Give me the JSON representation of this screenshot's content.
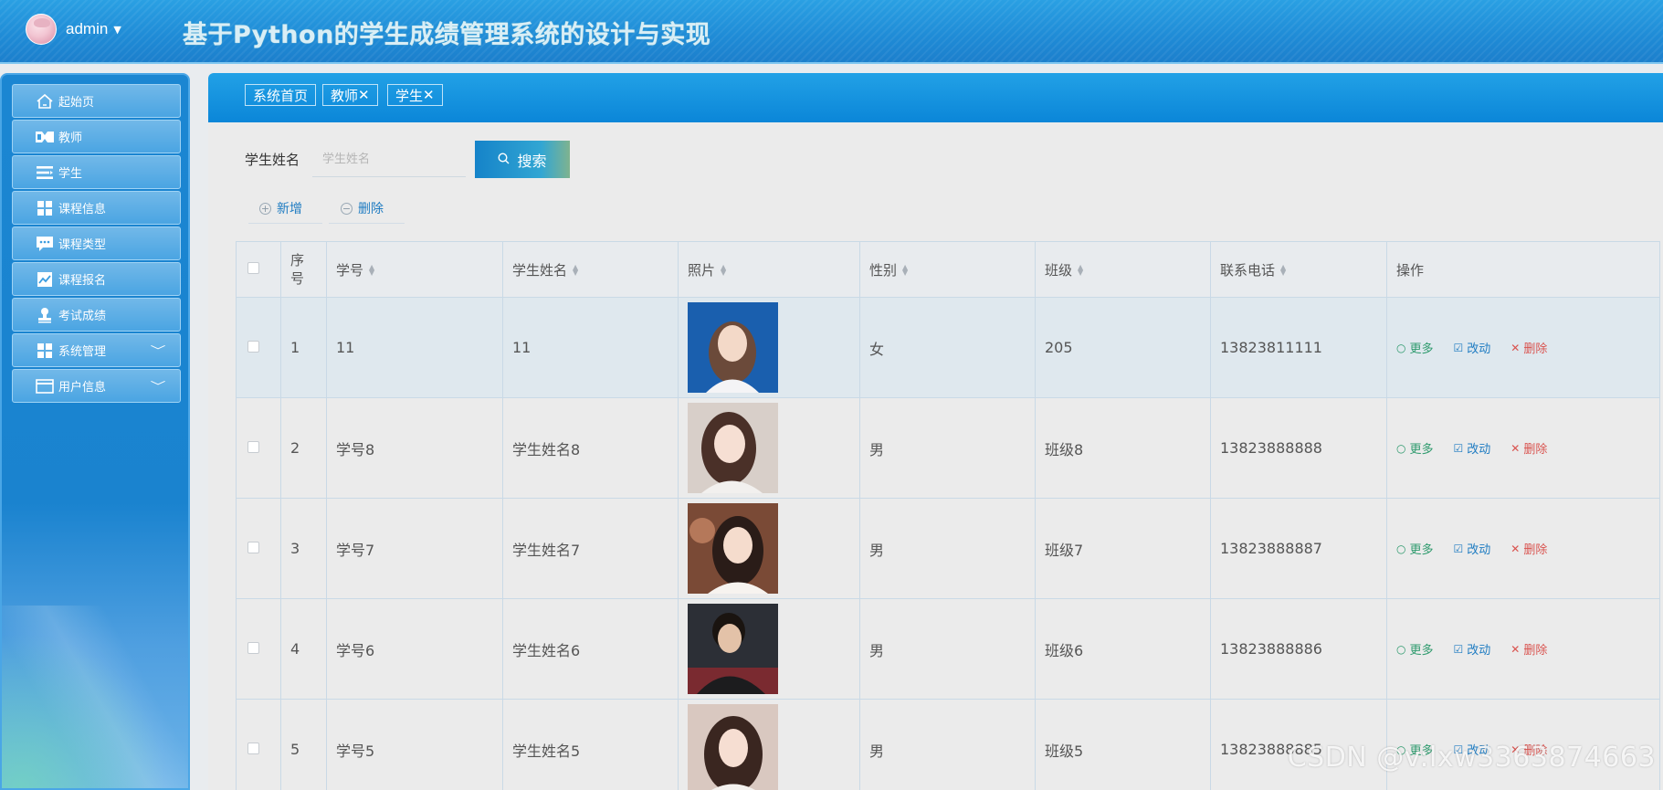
{
  "header": {
    "user_name": "admin",
    "caret": "▼",
    "title": "基于Python的学生成绩管理系统的设计与实现"
  },
  "sidebar": {
    "items": [
      {
        "label": "起始页",
        "icon": "home-icon"
      },
      {
        "label": "教师",
        "icon": "teacher-icon"
      },
      {
        "label": "学生",
        "icon": "list-icon"
      },
      {
        "label": "课程信息",
        "icon": "grid-icon"
      },
      {
        "label": "课程类型",
        "icon": "chat-icon"
      },
      {
        "label": "课程报名",
        "icon": "chart-icon"
      },
      {
        "label": "考试成绩",
        "icon": "stamp-icon"
      },
      {
        "label": "系统管理",
        "icon": "grid-icon",
        "chevron": "﹀"
      },
      {
        "label": "用户信息",
        "icon": "card-icon",
        "chevron": "﹀"
      }
    ]
  },
  "tabs": [
    {
      "label": "系统首页"
    },
    {
      "label": "教师",
      "close": "✕"
    },
    {
      "label": "学生",
      "close": "✕"
    }
  ],
  "search": {
    "label": "学生姓名",
    "placeholder": "学生姓名",
    "value": "",
    "button_label": "搜索",
    "button_icon": "search-icon"
  },
  "actions": {
    "add_label": "新增",
    "add_icon": "plus-circle-icon",
    "delete_label": "删除",
    "delete_icon": "minus-circle-icon"
  },
  "table": {
    "headers": {
      "index": "序号",
      "student_no": "学号",
      "student_name": "学生姓名",
      "photo": "照片",
      "gender": "性别",
      "class": "班级",
      "phone": "联系电话",
      "ops": "操作"
    },
    "op_labels": {
      "more": "更多",
      "edit": "改动",
      "delete": "删除"
    },
    "rows": [
      {
        "index": "1",
        "student_no": "11",
        "student_name": "11",
        "gender": "女",
        "class": "205",
        "phone": "13823811111",
        "selected": true
      },
      {
        "index": "2",
        "student_no": "学号8",
        "student_name": "学生姓名8",
        "gender": "男",
        "class": "班级8",
        "phone": "13823888888"
      },
      {
        "index": "3",
        "student_no": "学号7",
        "student_name": "学生姓名7",
        "gender": "男",
        "class": "班级7",
        "phone": "13823888887"
      },
      {
        "index": "4",
        "student_no": "学号6",
        "student_name": "学生姓名6",
        "gender": "男",
        "class": "班级6",
        "phone": "13823888886"
      },
      {
        "index": "5",
        "student_no": "学号5",
        "student_name": "学生姓名5",
        "gender": "男",
        "class": "班级5",
        "phone": "13823888885"
      }
    ]
  },
  "watermark": "CSDN @v:lxw3363874663",
  "colors": {
    "header_blue": "#1f8bd6",
    "menu_blue": "#3b9de0",
    "op_more": "#2e9a6d",
    "op_edit": "#1f7cc2",
    "op_delete": "#d9534f"
  }
}
